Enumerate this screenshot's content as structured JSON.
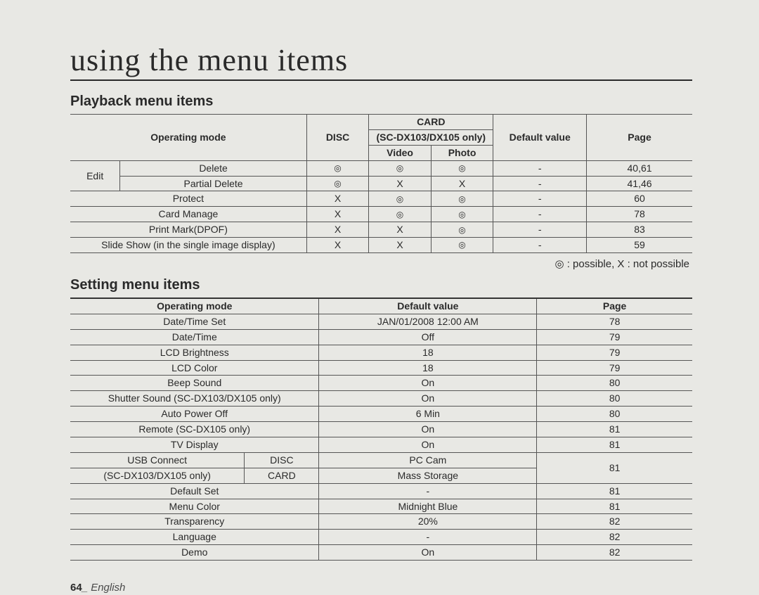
{
  "pageTitle": "using the menu items",
  "playback": {
    "heading": "Playback menu items",
    "headers": {
      "operatingMode": "Operating mode",
      "disc": "DISC",
      "card": "CARD",
      "cardSub": "(SC-DX103/DX105 only)",
      "video": "Video",
      "photo": "Photo",
      "defaultValue": "Default value",
      "page": "Page"
    },
    "editLabel": "Edit",
    "rows": [
      {
        "mode": "Delete",
        "disc": "◎",
        "video": "◎",
        "photo": "◎",
        "def": "-",
        "page": "40,61"
      },
      {
        "mode": "Partial Delete",
        "disc": "◎",
        "video": "X",
        "photo": "X",
        "def": "-",
        "page": "41,46"
      },
      {
        "mode": "Protect",
        "disc": "X",
        "video": "◎",
        "photo": "◎",
        "def": "-",
        "page": "60"
      },
      {
        "mode": "Card Manage",
        "disc": "X",
        "video": "◎",
        "photo": "◎",
        "def": "-",
        "page": "78"
      },
      {
        "mode": "Print Mark(DPOF)",
        "disc": "X",
        "video": "X",
        "photo": "◎",
        "def": "-",
        "page": "83"
      },
      {
        "mode": "Slide Show (in the single image display)",
        "disc": "X",
        "video": "X",
        "photo": "◎",
        "def": "-",
        "page": "59"
      }
    ],
    "legend": "◎ : possible, X : not possible"
  },
  "setting": {
    "heading": "Setting menu items",
    "headers": {
      "operatingMode": "Operating mode",
      "defaultValue": "Default value",
      "page": "Page"
    },
    "rows": [
      {
        "mode": "Date/Time Set",
        "def": "JAN/01/2008 12:00 AM",
        "page": "78"
      },
      {
        "mode": "Date/Time",
        "def": "Off",
        "page": "79"
      },
      {
        "mode": "LCD Brightness",
        "def": "18",
        "page": "79"
      },
      {
        "mode": "LCD Color",
        "def": "18",
        "page": "79"
      },
      {
        "mode": "Beep Sound",
        "def": "On",
        "page": "80"
      },
      {
        "mode": "Shutter Sound (SC-DX103/DX105 only)",
        "def": "On",
        "page": "80"
      },
      {
        "mode": "Auto Power Off",
        "def": "6 Min",
        "page": "80"
      },
      {
        "mode": "Remote (SC-DX105 only)",
        "def": "On",
        "page": "81"
      },
      {
        "mode": "TV Display",
        "def": "On",
        "page": "81"
      }
    ],
    "usb": {
      "left1": "USB Connect",
      "left2": "(SC-DX103/DX105 only)",
      "discLabel": "DISC",
      "cardLabel": "CARD",
      "discVal": "PC Cam",
      "cardVal": "Mass Storage",
      "page": "81"
    },
    "rows2": [
      {
        "mode": "Default Set",
        "def": "-",
        "page": "81"
      },
      {
        "mode": "Menu Color",
        "def": "Midnight Blue",
        "page": "81"
      },
      {
        "mode": "Transparency",
        "def": "20%",
        "page": "82"
      },
      {
        "mode": "Language",
        "def": "-",
        "page": "82"
      },
      {
        "mode": "Demo",
        "def": "On",
        "page": "82"
      }
    ]
  },
  "footer": {
    "pageNum": "64",
    "sep": "_ ",
    "lang": "English"
  }
}
